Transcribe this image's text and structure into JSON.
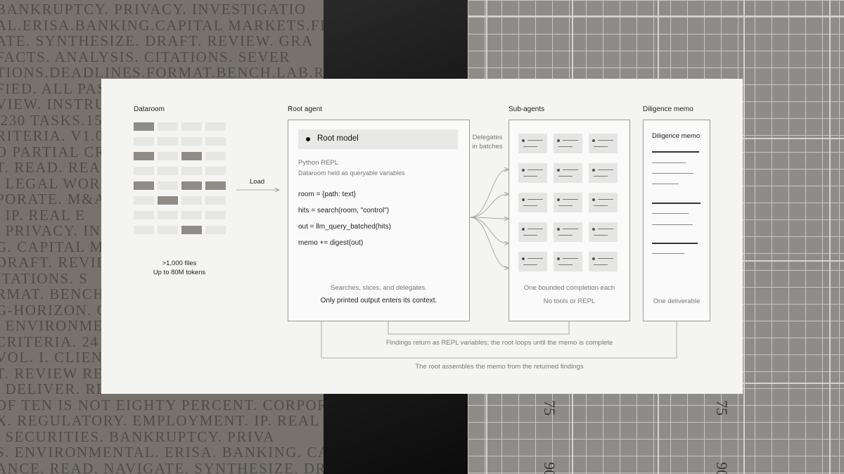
{
  "background": {
    "text_lines": [
      "BANKRUPTCY.     PRIVACY.     INVESTIGATIO",
      "AL.ERISA.BANKING.CAPITAL MARKETS.FINAN",
      "ATE.    SYNTHESIZE.    DRAFT.    REVIEW.    GRA",
      "FACTS.    ANALYSIS.    CITATIONS.    SEVER",
      "TIONS.DEADLINES.FORMAT.BENCH.LAB.RUBI",
      "FIED.  ALL  PASS",
      "VIEW.  INSTRU",
      ",230 TASKS.15,0",
      "RITERIA. V1.0",
      "O PARTIAL  CR",
      "T.  READ.  REA",
      ". LEGAL WORK",
      "PORATE.  M&A",
      ".  IP.  REAL  E",
      ".  PRIVACY.   INV",
      "G.  CAPITAL MA",
      "DRAFT.    REVIE",
      "ITATIONS.     S",
      "RMAT.  BENCH",
      "G-HORIZON.  O",
      ".  ENVIRONMENT",
      "CRITERIA.  24",
      "VOL. I. CLIENT",
      "T.  REVIEW RE",
      ".  DELIVER.  REVI",
      "OF TEN IS NOT EIGHTY PERCENT. CORPORATE. M",
      "X. REGULATORY. EMPLOYMENT. IP. REAL ESTA",
      ".  SECURITIES.      BANKRUPTCY.      PRIVA",
      "S. ENVIRONMENTAL. ERISA. BANKING. CAPI",
      "ANCE.  READ.  NAVIGATE.  SYNTHESIZE.  DRA"
    ],
    "numbers": [
      "75",
      "75",
      "90",
      "90"
    ]
  },
  "dataroom": {
    "title": "Dataroom",
    "grid": [
      [
        1,
        0,
        0,
        0
      ],
      [
        0,
        0,
        0,
        0
      ],
      [
        1,
        0,
        1,
        0
      ],
      [
        0,
        0,
        0,
        0
      ],
      [
        1,
        0,
        1,
        1
      ],
      [
        0,
        1,
        0,
        0
      ],
      [
        0,
        0,
        0,
        0
      ],
      [
        0,
        0,
        1,
        0
      ]
    ],
    "files_line": ">1,000 files",
    "tokens_line": "Up to 80M tokens",
    "colors": {
      "light": "#e6e6e5",
      "dark": "#8f8c88"
    }
  },
  "load_label": "Load",
  "root_agent": {
    "title": "Root agent",
    "model_label": "Root model",
    "repl_label": "Python REPL",
    "repl_sub": "Dataroom held as queryable variables",
    "code_lines": [
      "room = {path: text}",
      "hits = search(room, \"control\")",
      "out = llm_query_batched(hits)",
      "memo += digest(out)"
    ],
    "footer1": "Searches, slices, and delegates.",
    "footer2": "Only printed output enters its context."
  },
  "delegates_label_1": "Delegates",
  "delegates_label_2": "in batches",
  "sub_agents": {
    "title": "Sub-agents",
    "rows": 5,
    "cols": 3,
    "footer1": "One bounded completion each",
    "footer2": "No tools or REPL"
  },
  "memo": {
    "title": "Diligence memo",
    "heading": "Diligence memo",
    "footer": "One deliverable"
  },
  "loop_caption": "Findings return as REPL variables; the root loops until the memo is complete",
  "assemble_caption": "The root assembles the memo from the returned findings"
}
